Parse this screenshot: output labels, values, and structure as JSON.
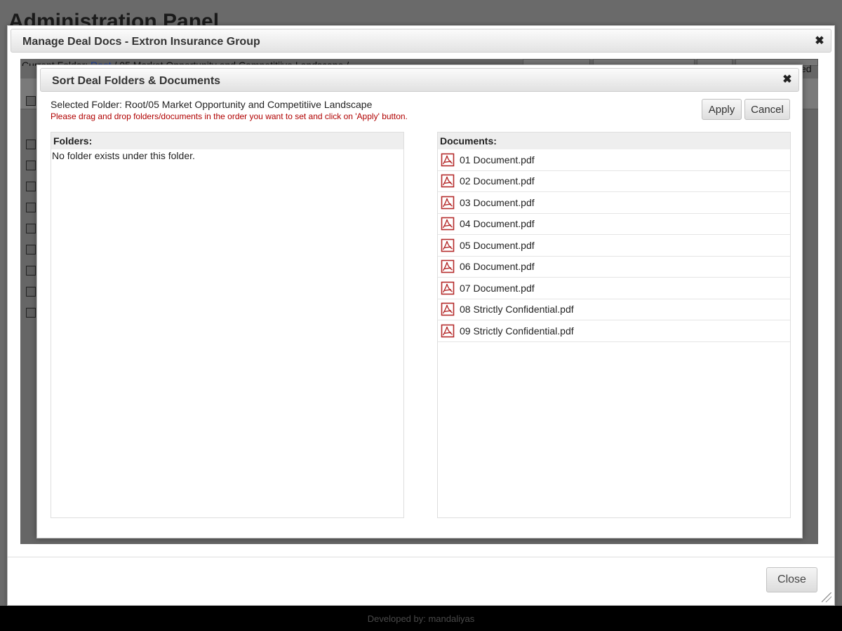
{
  "background": {
    "page_title": "Administration Panel",
    "footer_text": "Developed by: mandaliyas",
    "current_folder_label": "Current Folder:",
    "current_folder_root_link": "Root",
    "current_folder_path": "/ 05 Market Opportunity and Competitiive Landscape /",
    "toolbar_partial_label": "ed"
  },
  "outer_dialog": {
    "title": "Manage Deal Docs - Extron Insurance Group",
    "close_icon": "close-icon",
    "close_button_label": "Close"
  },
  "inner_dialog": {
    "title": "Sort Deal Folders & Documents",
    "close_icon": "close-icon",
    "selected_folder": "Selected Folder: Root/05 Market Opportunity and Competitiive Landscape",
    "instructions": "Please drag and drop folders/documents in the order you want to set and click on 'Apply' button.",
    "apply_label": "Apply",
    "cancel_label": "Cancel",
    "folders": {
      "header": "Folders:",
      "empty_message": "No folder exists under this folder."
    },
    "documents": {
      "header": "Documents:",
      "icon": "pdf-icon",
      "items": [
        {
          "name": "01 Document.pdf"
        },
        {
          "name": "02 Document.pdf"
        },
        {
          "name": "03 Document.pdf"
        },
        {
          "name": "04 Document.pdf"
        },
        {
          "name": "05 Document.pdf"
        },
        {
          "name": "06 Document.pdf"
        },
        {
          "name": "07 Document.pdf"
        },
        {
          "name": "08 Strictly Confidential.pdf"
        },
        {
          "name": "09 Strictly Confidential.pdf"
        }
      ]
    }
  },
  "colors": {
    "overlay": "#6a6a6a",
    "instruction_text": "#b00000",
    "pdf_icon": "#b52b2b"
  }
}
